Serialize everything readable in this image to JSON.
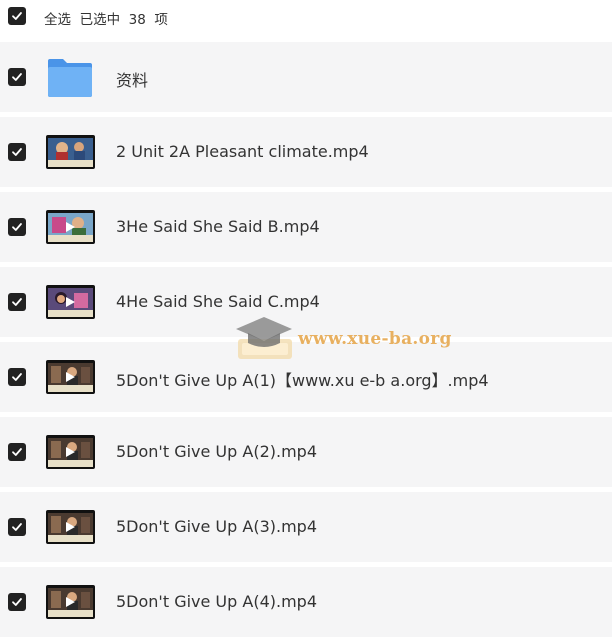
{
  "header": {
    "selection_text": "全选  已选中  38  项"
  },
  "items": [
    {
      "type": "folder",
      "name": "资料",
      "checked": true
    },
    {
      "type": "video",
      "name": "2 Unit 2A Pleasant climate.mp4",
      "checked": true
    },
    {
      "type": "video",
      "name": "3He Said She Said B.mp4",
      "checked": true
    },
    {
      "type": "video",
      "name": "4He Said She Said C.mp4",
      "checked": true
    },
    {
      "type": "video",
      "name": "5Don't Give Up A(1)【www.xu e-b a.org】.mp4",
      "checked": true
    },
    {
      "type": "video",
      "name": "5Don't Give Up A(2).mp4",
      "checked": true
    },
    {
      "type": "video",
      "name": "5Don't Give Up A(3).mp4",
      "checked": true
    },
    {
      "type": "video",
      "name": "5Don't Give Up A(4).mp4",
      "checked": true
    }
  ],
  "watermark": {
    "text": "www.xue-ba.org"
  },
  "colors": {
    "row_bg": "#f5f5f6",
    "checkbox": "#222222",
    "folder": "#5aa3f0",
    "watermark": "#e8b060"
  }
}
